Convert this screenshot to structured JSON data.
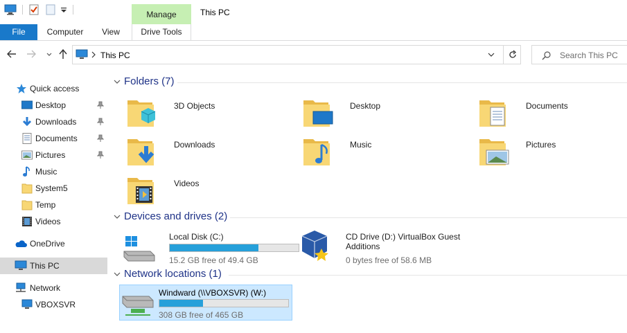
{
  "window": {
    "title": "This PC"
  },
  "ribbon": {
    "context_label": "Manage",
    "tabs": [
      {
        "label": "File"
      },
      {
        "label": "Computer"
      },
      {
        "label": "View"
      },
      {
        "label": "Drive Tools"
      }
    ]
  },
  "address": {
    "path": "This PC",
    "search_placeholder": "Search This PC"
  },
  "nav": {
    "quick_access": "Quick access",
    "items": [
      {
        "label": "Desktop",
        "pinned": true
      },
      {
        "label": "Downloads",
        "pinned": true
      },
      {
        "label": "Documents",
        "pinned": true
      },
      {
        "label": "Pictures",
        "pinned": true
      },
      {
        "label": "Music",
        "pinned": false
      },
      {
        "label": "System5",
        "pinned": false
      },
      {
        "label": "Temp",
        "pinned": false
      },
      {
        "label": "Videos",
        "pinned": false
      }
    ],
    "onedrive": "OneDrive",
    "thispc": "This PC",
    "network": "Network",
    "network_child": "VBOXSVR"
  },
  "groups": {
    "folders": "Folders (7)",
    "devices": "Devices and drives (2)",
    "network": "Network locations (1)"
  },
  "folders": [
    {
      "name": "3D Objects"
    },
    {
      "name": "Desktop"
    },
    {
      "name": "Documents"
    },
    {
      "name": "Downloads"
    },
    {
      "name": "Music"
    },
    {
      "name": "Pictures"
    },
    {
      "name": "Videos"
    }
  ],
  "drives": [
    {
      "name": "Local Disk (C:)",
      "free": "15.2 GB free of 49.4 GB",
      "used_fraction": 0.69
    },
    {
      "name_line1": "CD Drive (D:) VirtualBox Guest",
      "name_line2": "Additions",
      "free": "0 bytes free of 58.6 MB"
    }
  ],
  "network_locations": [
    {
      "name": "Windward (\\\\VBOXSVR) (W:)",
      "free": "308 GB free of 465 GB",
      "used_fraction": 0.34
    }
  ],
  "colors": {
    "accent": "#1979ca",
    "bar_fill": "#26a0da",
    "folder": "#f8d775",
    "group_title": "#1e3287",
    "selected": "#cce8ff"
  }
}
